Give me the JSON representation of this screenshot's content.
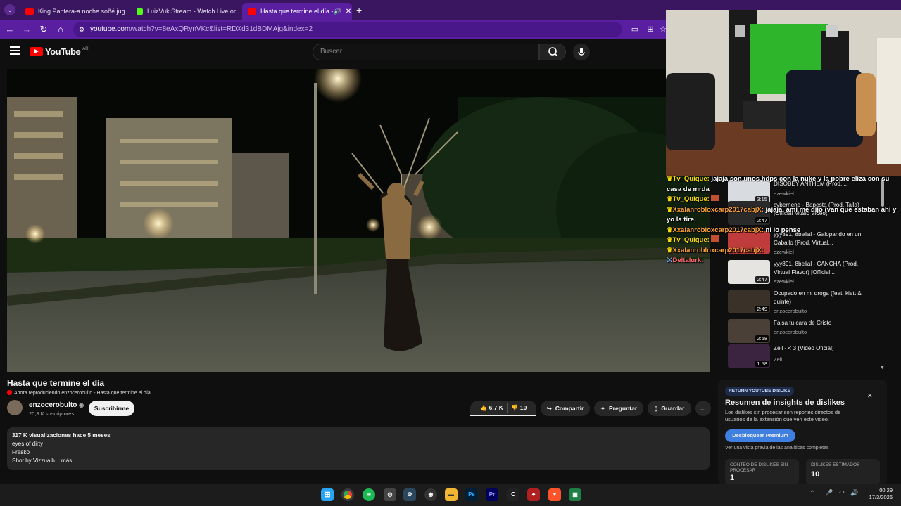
{
  "browser": {
    "tabs": [
      {
        "label": "King Pantera-a noche soñé jug"
      },
      {
        "label": "LuizVuk Stream - Watch Live or"
      },
      {
        "label": "Hasta que termine el día - "
      }
    ],
    "url_host": "youtube.com",
    "url_rest": "/watch?v=8eAxQRynVKc&list=RDXd31dBDMAjg&index=2"
  },
  "youtube": {
    "logo_text": "YouTube",
    "region": "AR",
    "search_placeholder": "Buscar"
  },
  "video": {
    "title": "Hasta que termine el día",
    "now_playing": "Ahora reproduciendo enzocerobulto - Hasta que termine el día",
    "channel": "enzocerobulto",
    "subscribers": "20,3 K suscriptores",
    "subscribe_label": "Suscribirme",
    "likes": "6,7 K",
    "dislikes": "10",
    "share_label": "Compartir",
    "ask_label": "Preguntar",
    "save_label": "Guardar",
    "more_label": "…"
  },
  "description": {
    "stats": "317 K visualizaciones  hace 5 meses",
    "lines": [
      "eyes of dirty",
      "Fresko",
      "Shot by Vizzualb ...más"
    ]
  },
  "chat": [
    {
      "user": "Tv_Quique:",
      "text": "jajaja son unos hdps con la nuke y la pobre eliza con su casa de mrda"
    },
    {
      "user": "Tv_Quique:",
      "text": ""
    },
    {
      "user": "Xxalanrobloxcarp2017cabjX:",
      "text": "jajaja, ami me dijo (van que estaban ahi y yo la tire,"
    },
    {
      "user": "Xxalanrobloxcarp2017cabjX:",
      "text": "ni lo pense"
    },
    {
      "user": "Tv_Quique:",
      "text": ""
    },
    {
      "user": "Xxalanrobloxcarp2017cabjX:",
      "text": ""
    },
    {
      "user": "Deltalurk:",
      "text": ""
    }
  ],
  "recommendations": [
    {
      "title": "DISOBEY ANTHEM (Prod....",
      "channel": "ezewkiel",
      "duration": "3:15"
    },
    {
      "title": "cybernene - Bapesta (Prod. Talla) [Official Music Video]",
      "channel": "",
      "duration": "2:47"
    },
    {
      "title": "yyy891, 8belial - Galopando en un Caballo (Prod. Virtual...",
      "channel": "ezewkiel",
      "duration": ""
    },
    {
      "title": "yyy891, 8belial - CANCHA (Prod. Virtual Flavor) [Official...",
      "channel": "ezewkiel",
      "duration": "2:47"
    },
    {
      "title": "Ocupado en mi droga (feat. kiett & quinte)",
      "channel": "enzocerobulto",
      "duration": "2:49"
    },
    {
      "title": "Falsa tu cara de Cristo",
      "channel": "enzocerobulto",
      "duration": "2:58"
    },
    {
      "title": "Zell -  < 3 (Video Oficial)",
      "channel": "Zell",
      "duration": "1:58"
    }
  ],
  "dislike_panel": {
    "badge": "RETURN YOUTUBE DISLIKE",
    "title": "Resumen de insights de dislikes",
    "body": "Los dislikes sin procesar son reportes directos de usuarios de la extensión que ven este video.",
    "button": "Desbloquear Premium",
    "preview": "Ver una vista previa de las analíticas completas",
    "card1_label": "CONTEO DE DISLIKES SIN PROCESAR",
    "card1_value": "1",
    "card2_label": "DISLIKES ESTIMADOS",
    "card2_value": "10"
  },
  "taskbar": {
    "time": "00:29",
    "date": "17/3/2026"
  },
  "colors": {
    "tab_bar": "#3a1660",
    "active_tab": "#5a1fa0",
    "youtube_red": "#ff0000",
    "chat_user": "#f5d90a"
  }
}
